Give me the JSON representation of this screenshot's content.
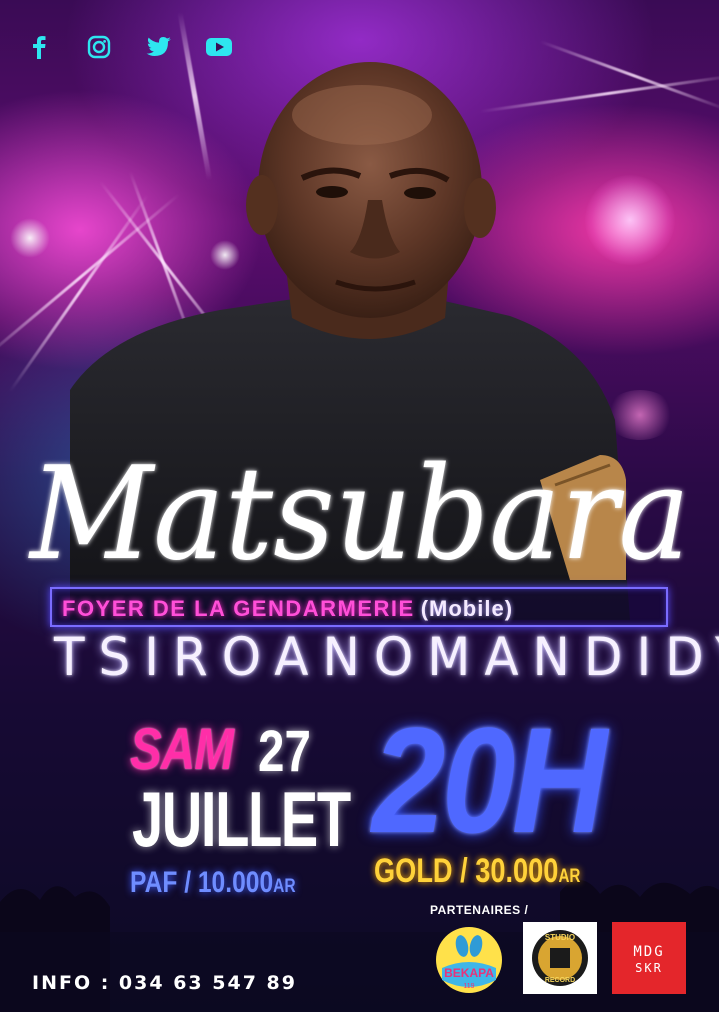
{
  "socials": [
    "facebook-icon",
    "instagram-icon",
    "twitter-icon",
    "youtube-icon"
  ],
  "artist": "Matsubara",
  "venue": "FOYER DE LA GENDARMERIE",
  "venue_suffix": "(Mobile)",
  "town": "TSIROANOMANDIDY",
  "day": "SAM",
  "date": "27",
  "month": "JUILLET",
  "paf_label": "PAF / 10.000",
  "paf_unit": "AR",
  "time": "20H",
  "gold_label": "GOLD / 30.000",
  "gold_unit": "AR",
  "partners_label": "PARTENAIRES /",
  "partners": {
    "bekapa": {
      "name": "BEKAPA",
      "sub": "119"
    },
    "studio": {
      "top": "STUDIO",
      "bottom": "RECORD"
    },
    "mdg": {
      "line1": "MDG",
      "line2": "SKR"
    }
  },
  "info": "INFO : 034 63 547 89",
  "colors": {
    "pink": "#ff2ea8",
    "blue": "#4f68ff",
    "gold": "#ffd23a",
    "violet": "#7a6cff",
    "red_logo": "#e4262b"
  }
}
